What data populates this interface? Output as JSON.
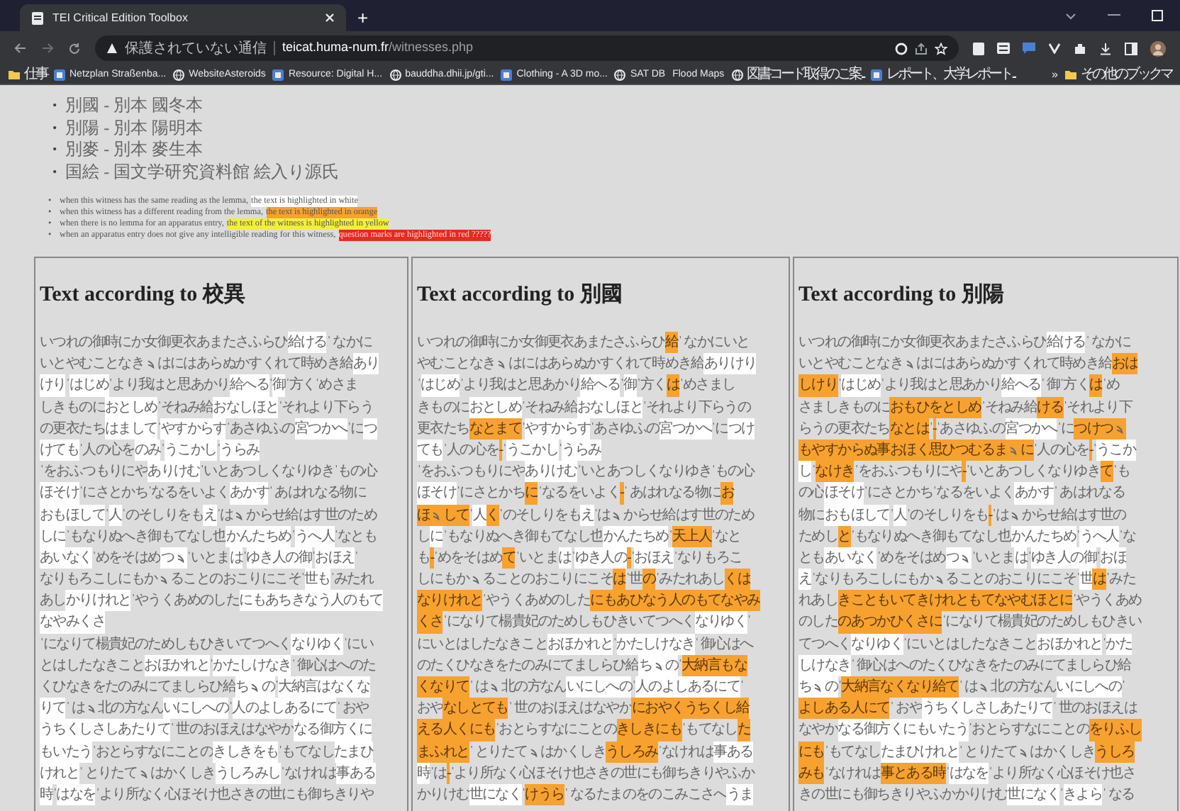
{
  "browser": {
    "tab": {
      "title": "TEI Critical Edition Toolbox",
      "selected": true
    },
    "new_tab": "+",
    "address": {
      "security": "保護されていない通信",
      "host": "teicat.huma-num.fr",
      "path": "/witnesses.php"
    },
    "bookmarks": [
      {
        "label": "仕事"
      },
      {
        "label": "Netzplan Straßenba..."
      },
      {
        "label": "WebsiteAsteroids"
      },
      {
        "label": "Resource: Digital H..."
      },
      {
        "label": "bauddha.dhii.jp/gti..."
      },
      {
        "label": "Clothing - A 3D mo..."
      },
      {
        "label": "SAT DB"
      },
      {
        "label": "Flood Maps"
      },
      {
        "label": "図書コード取得のご案..."
      },
      {
        "label": "レポート、大学レポート..."
      }
    ],
    "more": "»",
    "other_bookmarks": "その他のブックマ"
  },
  "witnesses": [
    {
      "bullet": "•",
      "text": "別國 - 別本 國冬本"
    },
    {
      "bullet": "•",
      "text": "別陽 - 別本 陽明本"
    },
    {
      "bullet": "•",
      "text": "別麥 - 別本 麥生本"
    },
    {
      "bullet": "•",
      "text": "国絵 - 国文学研究資料館 絵入り源氏"
    }
  ],
  "legend": [
    {
      "bullet": "•",
      "lead": "when this witness has the same reading as the lemma,",
      "highlight": "the text is highlighted in white",
      "kind": "same"
    },
    {
      "bullet": "•",
      "lead": "when this witness has a different reading from the lemma,",
      "highlight": "the text is highlighted in orange",
      "kind": "different"
    },
    {
      "bullet": "•",
      "lead": "when there is no lemma for an apparatus entry,",
      "highlight": "the text of the witness is highlighted in yellow",
      "kind": "no_lemma"
    },
    {
      "bullet": "•",
      "lead": "when an apparatus entry does not give any intelligible reading for this witness,",
      "highlight": "question marks are highlighted in red ?????",
      "kind": "unintelligible"
    }
  ],
  "columns": [
    {
      "heading": "Text according to 校異",
      "lines": [
        [
          {
            "kind": "plain",
            "text": "いつれの御時にか女御更衣あまたさふらひ "
          },
          {
            "kind": "same",
            "text": "給ける"
          },
          {
            "kind": "plain",
            "text": "ˈ なかに"
          }
        ],
        [
          {
            "kind": "plain",
            "text": "いとやむことなき"
          },
          {
            "kind": "repeat_plain"
          },
          {
            "kind": "plain",
            "text": "はにはあらぬかすくれて時めき給 "
          },
          {
            "kind": "same",
            "text": "あり"
          }
        ],
        [
          {
            "kind": "same",
            "text": "けり"
          },
          {
            "kind": "plain",
            "text": "ˈ "
          },
          {
            "kind": "same",
            "text": "はじめ"
          },
          {
            "kind": "plain",
            "text": "ˈより我はと思あかり "
          },
          {
            "kind": "same",
            "text": "給へる"
          },
          {
            "kind": "plain",
            "text": "ˈ "
          },
          {
            "kind": "same",
            "text": "御"
          },
          {
            "kind": "plain",
            "text": "ˈ方くˈめさま"
          }
        ],
        [
          {
            "kind": "plain",
            "text": "しきものに"
          },
          {
            "kind": "same",
            "text": "おとしめ"
          },
          {
            "kind": "plain",
            "text": "ˈそねみ給"
          },
          {
            "kind": "same",
            "text": "おなしほと"
          },
          {
            "kind": "plain",
            "text": "ˈそれより下らう"
          }
        ],
        [
          {
            "kind": "plain",
            "text": "の更衣たち"
          },
          {
            "kind": "same",
            "text": "はまして"
          },
          {
            "kind": "plain",
            "text": "ˈ"
          },
          {
            "kind": "same",
            "text": "やすからす"
          },
          {
            "kind": "plain",
            "text": "ˈあさゆふの"
          },
          {
            "kind": "same",
            "text": "宮つかへ"
          },
          {
            "kind": "plain",
            "text": "ˈに"
          },
          {
            "kind": "same",
            "text": "つ"
          }
        ],
        [
          {
            "kind": "same",
            "text": "けても"
          },
          {
            "kind": "plain",
            "text": "ˈ人の心を"
          },
          {
            "kind": "same",
            "text": "のみ"
          },
          {
            "kind": "plain",
            "text": "ˈ"
          },
          {
            "kind": "same",
            "text": "うこかし"
          },
          {
            "kind": "plain",
            "text": "ˈ"
          },
          {
            "kind": "same",
            "text": "うらみ"
          }
        ],
        [
          {
            "kind": "plain",
            "text": "ˈをおふつもりにや"
          },
          {
            "kind": "same",
            "text": "ありけむ"
          },
          {
            "kind": "plain",
            "text": "ˈいとあつしくなりゆきˈもの心"
          }
        ],
        [
          {
            "kind": "same",
            "text": "ほそけ"
          },
          {
            "kind": "plain",
            "text": "ˈにさとかちˈなるをいよく"
          },
          {
            "kind": "same",
            "text": "あかす"
          },
          {
            "kind": "plain",
            "text": "ˈ あはれなる物に"
          }
        ],
        [
          {
            "kind": "same",
            "text": "おもほして"
          },
          {
            "kind": "plain",
            "text": "ˈ"
          },
          {
            "kind": "same",
            "text": "人"
          },
          {
            "kind": "plain",
            "text": "ˈのそしりをも"
          },
          {
            "kind": "same",
            "text": "え"
          },
          {
            "kind": "plain",
            "text": "ˈは"
          },
          {
            "kind": "repeat_plain"
          },
          {
            "kind": "plain",
            "text": "からせ給はす世のため"
          }
        ],
        [
          {
            "kind": "same",
            "text": "しに"
          },
          {
            "kind": "plain",
            "text": "ˈもなりぬへき御もてなし也"
          },
          {
            "kind": "same",
            "text": "かんたちめ"
          },
          {
            "kind": "plain",
            "text": "ˈ"
          },
          {
            "kind": "same",
            "text": "うへ人"
          },
          {
            "kind": "plain",
            "text": "ˈなとも"
          }
        ],
        [
          {
            "kind": "same",
            "text": "あいなく"
          },
          {
            "kind": "plain",
            "text": "ˈめをそはめ"
          },
          {
            "kind": "same",
            "text": "つ"
          },
          {
            "kind": "repeat_same"
          },
          {
            "kind": "plain",
            "text": "ˈいとま"
          },
          {
            "kind": "same",
            "text": "は"
          },
          {
            "kind": "plain",
            "text": "ˈ"
          },
          {
            "kind": "same",
            "text": "ゆき人の御"
          },
          {
            "kind": "plain",
            "text": "ˈ"
          },
          {
            "kind": "same",
            "text": "おほえ"
          },
          {
            "kind": "plain",
            "text": "ˈ"
          }
        ],
        [
          {
            "kind": "plain",
            "text": "なりもろこしにもか"
          },
          {
            "kind": "repeat_plain"
          },
          {
            "kind": "plain",
            "text": "ることのおこりにこそˈ"
          },
          {
            "kind": "same",
            "text": "世も"
          },
          {
            "kind": "plain",
            "text": "ˈみたれ"
          }
        ],
        [
          {
            "kind": "plain",
            "text": "あし"
          },
          {
            "kind": "same",
            "text": "かりけれと"
          },
          {
            "kind": "plain",
            "text": "ˈやうくあめのした"
          },
          {
            "kind": "same",
            "text": "にもあちきなう人のもて"
          }
        ],
        [
          {
            "kind": "same",
            "text": "なやみくさ"
          }
        ],
        [
          {
            "kind": "plain",
            "text": "ˈになりて楊貴妃のためしもひきいてつへく"
          },
          {
            "kind": "same",
            "text": "なりゆく"
          },
          {
            "kind": "plain",
            "text": "ˈにい"
          }
        ],
        [
          {
            "kind": "plain",
            "text": "とはしたなきこと"
          },
          {
            "kind": "same",
            "text": "おほかれと"
          },
          {
            "kind": "plain",
            "text": "ˈ "
          },
          {
            "kind": "same",
            "text": "かたしけなき"
          },
          {
            "kind": "plain",
            "text": "ˈ 御心はへのた"
          }
        ],
        [
          {
            "kind": "plain",
            "text": "くひなきをたのみにてましらひ給"
          },
          {
            "kind": "same",
            "text": "ち"
          },
          {
            "kind": "repeat_same"
          },
          {
            "kind": "same",
            "text": "の"
          },
          {
            "kind": "plain",
            "text": "ˈ "
          },
          {
            "kind": "same",
            "text": "大納言はなくな"
          }
        ],
        [
          {
            "kind": "same",
            "text": "りて"
          },
          {
            "kind": "plain",
            "text": "ˈ は"
          },
          {
            "kind": "repeat_plain"
          },
          {
            "kind": "plain",
            "text": "北の方なん"
          },
          {
            "kind": "same",
            "text": "いにしへの"
          },
          {
            "kind": "plain",
            "text": "ˈ "
          },
          {
            "kind": "same",
            "text": "人のよしあるにて"
          },
          {
            "kind": "plain",
            "text": "ˈ おや"
          }
        ],
        [
          {
            "kind": "same",
            "text": "うちくしさしあたりて"
          },
          {
            "kind": "plain",
            "text": "ˈ 世のおほえはなやか"
          },
          {
            "kind": "same",
            "text": "なる御方くに"
          }
        ],
        [
          {
            "kind": "same",
            "text": "もいたう"
          },
          {
            "kind": "plain",
            "text": "ˈおとらすなにことの"
          },
          {
            "kind": "same",
            "text": "きしきをも"
          },
          {
            "kind": "plain",
            "text": "ˈもてなし "
          },
          {
            "kind": "same",
            "text": "たまひ"
          }
        ],
        [
          {
            "kind": "same",
            "text": "けれと"
          },
          {
            "kind": "plain",
            "text": "ˈ とりたて"
          },
          {
            "kind": "repeat_plain"
          },
          {
            "kind": "plain",
            "text": "はかくしき"
          },
          {
            "kind": "same",
            "text": "うしろみし"
          },
          {
            "kind": "plain",
            "text": "ˈなけれは"
          },
          {
            "kind": "same",
            "text": "事ある"
          }
        ],
        [
          {
            "kind": "same",
            "text": "時"
          },
          {
            "kind": "plain",
            "text": "ˈ"
          },
          {
            "kind": "same",
            "text": "はなを"
          },
          {
            "kind": "plain",
            "text": "ˈより所なく心ほそけ也さきの世にも御ちきりや"
          }
        ]
      ]
    },
    {
      "heading": "Text according to 別國",
      "lines": [
        [
          {
            "kind": "plain",
            "text": "いつれの御時にか女御更衣あまたさふらひ "
          },
          {
            "kind": "different",
            "text": "給"
          },
          {
            "kind": "plain",
            "text": "ˈ なかにいと"
          }
        ],
        [
          {
            "kind": "plain",
            "text": "やむことなき"
          },
          {
            "kind": "repeat_plain"
          },
          {
            "kind": "plain",
            "text": "はにはあらぬかすくれて時めき給 "
          },
          {
            "kind": "same",
            "text": "ありけり"
          }
        ],
        [
          {
            "kind": "plain",
            "text": "ˈ "
          },
          {
            "kind": "same",
            "text": "はじめ"
          },
          {
            "kind": "plain",
            "text": "ˈより我はと思あかり "
          },
          {
            "kind": "same",
            "text": "給へる"
          },
          {
            "kind": "plain",
            "text": "ˈ "
          },
          {
            "kind": "same",
            "text": "御"
          },
          {
            "kind": "plain",
            "text": "ˈ方く"
          },
          {
            "kind": "different",
            "text": "は"
          },
          {
            "kind": "plain",
            "text": "ˈめさまし"
          }
        ],
        [
          {
            "kind": "plain",
            "text": "きものに"
          },
          {
            "kind": "same",
            "text": "おとしめ"
          },
          {
            "kind": "plain",
            "text": "ˈそねみ給"
          },
          {
            "kind": "same",
            "text": "おなしほと"
          },
          {
            "kind": "plain",
            "text": "ˈそれより下らうの"
          }
        ],
        [
          {
            "kind": "plain",
            "text": "更衣たち"
          },
          {
            "kind": "different",
            "text": "なとまて"
          },
          {
            "kind": "plain",
            "text": "ˈ"
          },
          {
            "kind": "same",
            "text": "やすからす"
          },
          {
            "kind": "plain",
            "text": "ˈあさゆふの"
          },
          {
            "kind": "same",
            "text": "宮つかへ"
          },
          {
            "kind": "plain",
            "text": "ˈに"
          },
          {
            "kind": "same",
            "text": "つけ"
          }
        ],
        [
          {
            "kind": "same",
            "text": "ても"
          },
          {
            "kind": "plain",
            "text": "ˈ人の心を"
          },
          {
            "kind": "different",
            "text": "-"
          },
          {
            "kind": "plain",
            "text": "ˈ"
          },
          {
            "kind": "same",
            "text": "うこかし"
          },
          {
            "kind": "plain",
            "text": "ˈ"
          },
          {
            "kind": "same",
            "text": "うらみ"
          }
        ],
        [
          {
            "kind": "plain",
            "text": "ˈをおふつもりにや"
          },
          {
            "kind": "same",
            "text": "ありけむ"
          },
          {
            "kind": "plain",
            "text": "ˈいとあつしくなりゆきˈもの心"
          }
        ],
        [
          {
            "kind": "same",
            "text": "ほそけ"
          },
          {
            "kind": "plain",
            "text": "ˈにさとかち"
          },
          {
            "kind": "different",
            "text": "に"
          },
          {
            "kind": "plain",
            "text": "ˈなるをいよく"
          },
          {
            "kind": "different",
            "text": "-"
          },
          {
            "kind": "plain",
            "text": "ˈ あはれなる物に "
          },
          {
            "kind": "different",
            "text": "お"
          }
        ],
        [
          {
            "kind": "different",
            "text": "ほ"
          },
          {
            "kind": "repeat_different"
          },
          {
            "kind": "different",
            "text": "して"
          },
          {
            "kind": "plain",
            "text": "ˈ"
          },
          {
            "kind": "same",
            "text": "人"
          },
          {
            "kind": "different",
            "text": "く"
          },
          {
            "kind": "plain",
            "text": "ˈのそしりをも"
          },
          {
            "kind": "same",
            "text": "え"
          },
          {
            "kind": "plain",
            "text": "ˈは"
          },
          {
            "kind": "repeat_plain"
          },
          {
            "kind": "plain",
            "text": "からせ給はす世のため"
          }
        ],
        [
          {
            "kind": "plain",
            "text": "し"
          },
          {
            "kind": "same",
            "text": "に"
          },
          {
            "kind": "plain",
            "text": "ˈもなりぬへき御もてなし也"
          },
          {
            "kind": "same",
            "text": "かんたちめ"
          },
          {
            "kind": "plain",
            "text": "ˈ"
          },
          {
            "kind": "different",
            "text": "天上人"
          },
          {
            "kind": "plain",
            "text": "ˈなと"
          }
        ],
        [
          {
            "kind": "plain",
            "text": "も"
          },
          {
            "kind": "different",
            "text": "-"
          },
          {
            "kind": "plain",
            "text": "ˈめをそはめ"
          },
          {
            "kind": "different",
            "text": "て"
          },
          {
            "kind": "plain",
            "text": "ˈいとま"
          },
          {
            "kind": "same",
            "text": "は"
          },
          {
            "kind": "plain",
            "text": "ˈ"
          },
          {
            "kind": "same",
            "text": "ゆき人の"
          },
          {
            "kind": "different",
            "text": "-"
          },
          {
            "kind": "plain",
            "text": "ˈ"
          },
          {
            "kind": "same",
            "text": "おほえ"
          },
          {
            "kind": "plain",
            "text": "ˈなりもろこ"
          }
        ],
        [
          {
            "kind": "plain",
            "text": "しにもか"
          },
          {
            "kind": "repeat_plain"
          },
          {
            "kind": "plain",
            "text": "ることのおこりにこそ"
          },
          {
            "kind": "different",
            "text": "は"
          },
          {
            "kind": "plain",
            "text": "ˈ世"
          },
          {
            "kind": "different",
            "text": "の"
          },
          {
            "kind": "plain",
            "text": "ˈみたれあし"
          },
          {
            "kind": "different",
            "text": "くは"
          }
        ],
        [
          {
            "kind": "different",
            "text": "なりけれと"
          },
          {
            "kind": "plain",
            "text": "ˈやうくあめのした"
          },
          {
            "kind": "different",
            "text": "にもあひなう人のもてなやみ"
          }
        ],
        [
          {
            "kind": "different",
            "text": "くさ"
          },
          {
            "kind": "plain",
            "text": "ˈになりて楊貴妃のためしもひきいてつへく"
          },
          {
            "kind": "same",
            "text": "なりゆく"
          },
          {
            "kind": "plain",
            "text": "ˈ"
          }
        ],
        [
          {
            "kind": "plain",
            "text": "にいとはしたなきこと"
          },
          {
            "kind": "same",
            "text": "おほかれと"
          },
          {
            "kind": "plain",
            "text": "ˈ "
          },
          {
            "kind": "same",
            "text": "かたしけなき"
          },
          {
            "kind": "plain",
            "text": "ˈ 御心はへ"
          }
        ],
        [
          {
            "kind": "plain",
            "text": "のたくひなきをたのみにてましらひ給"
          },
          {
            "kind": "same",
            "text": "ち"
          },
          {
            "kind": "repeat_same"
          },
          {
            "kind": "same",
            "text": "の"
          },
          {
            "kind": "plain",
            "text": "ˈ "
          },
          {
            "kind": "different",
            "text": "大納言もな"
          }
        ],
        [
          {
            "kind": "different",
            "text": "くなりて"
          },
          {
            "kind": "plain",
            "text": "ˈ は"
          },
          {
            "kind": "repeat_plain"
          },
          {
            "kind": "plain",
            "text": "北の方なん"
          },
          {
            "kind": "same",
            "text": "いにしへの"
          },
          {
            "kind": "plain",
            "text": "ˈ "
          },
          {
            "kind": "same",
            "text": "人のよしあるにて"
          },
          {
            "kind": "plain",
            "text": "ˈ"
          }
        ],
        [
          {
            "kind": "plain",
            "text": "おや"
          },
          {
            "kind": "different",
            "text": "なしとても"
          },
          {
            "kind": "plain",
            "text": "ˈ 世のおほえはなやか"
          },
          {
            "kind": "different",
            "text": "におやくうちくし給"
          }
        ],
        [
          {
            "kind": "different",
            "text": "える人くにも"
          },
          {
            "kind": "plain",
            "text": "ˈおとらすなにことの"
          },
          {
            "kind": "different",
            "text": "きしきにも"
          },
          {
            "kind": "plain",
            "text": "ˈもてなし "
          },
          {
            "kind": "different",
            "text": "た"
          }
        ],
        [
          {
            "kind": "different",
            "text": "まふれと"
          },
          {
            "kind": "plain",
            "text": "ˈ とりたて"
          },
          {
            "kind": "repeat_plain"
          },
          {
            "kind": "plain",
            "text": "はかくしき"
          },
          {
            "kind": "different",
            "text": "うしろみ"
          },
          {
            "kind": "plain",
            "text": "ˈなけれは"
          },
          {
            "kind": "same",
            "text": "事ある"
          }
        ],
        [
          {
            "kind": "same",
            "text": "時"
          },
          {
            "kind": "plain",
            "text": "ˈは"
          },
          {
            "kind": "different",
            "text": "-"
          },
          {
            "kind": "plain",
            "text": "ˈより所なく心ほそけ也さきの世にも御ちきりやふか"
          }
        ],
        [
          {
            "kind": "plain",
            "text": "かりけむ"
          },
          {
            "kind": "same",
            "text": "世になく"
          },
          {
            "kind": "plain",
            "text": "ˈ "
          },
          {
            "kind": "different",
            "text": "けうら"
          },
          {
            "kind": "plain",
            "text": "ˈ なるたまのをのこみこさへ"
          },
          {
            "kind": "same",
            "text": "うま"
          }
        ]
      ]
    },
    {
      "heading": "Text according to 別陽",
      "lines": [
        [
          {
            "kind": "plain",
            "text": "いつれの御時にか女御更衣あまたさふらひ "
          },
          {
            "kind": "same",
            "text": "給ける"
          },
          {
            "kind": "plain",
            "text": "ˈ なかに"
          }
        ],
        [
          {
            "kind": "plain",
            "text": "いとやむことなき"
          },
          {
            "kind": "repeat_plain"
          },
          {
            "kind": "plain",
            "text": "はにはあらぬかすくれて時めき給 "
          },
          {
            "kind": "different",
            "text": "おは"
          }
        ],
        [
          {
            "kind": "different",
            "text": "しけり"
          },
          {
            "kind": "plain",
            "text": "ˈ "
          },
          {
            "kind": "same",
            "text": "はじめ"
          },
          {
            "kind": "plain",
            "text": "ˈより我はと思あかり "
          },
          {
            "kind": "same",
            "text": "給へる"
          },
          {
            "kind": "plain",
            "text": "ˈ 御ˈ方く"
          },
          {
            "kind": "different",
            "text": "は"
          },
          {
            "kind": "plain",
            "text": "ˈめ"
          }
        ],
        [
          {
            "kind": "plain",
            "text": "さましきものに"
          },
          {
            "kind": "different",
            "text": "おもひをとしめ"
          },
          {
            "kind": "plain",
            "text": "ˈそねみ給"
          },
          {
            "kind": "different",
            "text": "ける"
          },
          {
            "kind": "plain",
            "text": "ˈそれより下"
          }
        ],
        [
          {
            "kind": "plain",
            "text": "らうの更衣たち"
          },
          {
            "kind": "different",
            "text": "なとは"
          },
          {
            "kind": "plain",
            "text": "ˈ"
          },
          {
            "kind": "different",
            "text": "-"
          },
          {
            "kind": "plain",
            "text": "ˈあさゆふの"
          },
          {
            "kind": "same",
            "text": "宮つかへ"
          },
          {
            "kind": "plain",
            "text": "ˈに"
          },
          {
            "kind": "different",
            "text": "つけつ"
          },
          {
            "kind": "repeat_different"
          }
        ],
        [
          {
            "kind": "different",
            "text": "もやすからぬ事おほく思ひつむるま"
          },
          {
            "kind": "repeat_different"
          },
          {
            "kind": "different",
            "text": "に"
          },
          {
            "kind": "plain",
            "text": "ˈ人の心を"
          },
          {
            "kind": "different",
            "text": "-"
          },
          {
            "kind": "plain",
            "text": "ˈ"
          },
          {
            "kind": "same",
            "text": "うこか"
          }
        ],
        [
          {
            "kind": "same",
            "text": "し"
          },
          {
            "kind": "plain",
            "text": "ˈ"
          },
          {
            "kind": "different",
            "text": "なけき"
          },
          {
            "kind": "plain",
            "text": "ˈをおふつもりにや"
          },
          {
            "kind": "different",
            "text": "-"
          },
          {
            "kind": "plain",
            "text": "ˈいとあつしくなりゆき"
          },
          {
            "kind": "different",
            "text": "て"
          },
          {
            "kind": "plain",
            "text": "ˈも"
          }
        ],
        [
          {
            "kind": "plain",
            "text": "の心"
          },
          {
            "kind": "same",
            "text": "ほそけ"
          },
          {
            "kind": "plain",
            "text": "ˈにさとかちˈなるをいよく"
          },
          {
            "kind": "same",
            "text": "あかす"
          },
          {
            "kind": "plain",
            "text": "ˈ あはれなる"
          }
        ],
        [
          {
            "kind": "plain",
            "text": "物に "
          },
          {
            "kind": "same",
            "text": "おもほして"
          },
          {
            "kind": "plain",
            "text": "ˈ"
          },
          {
            "kind": "same",
            "text": "人"
          },
          {
            "kind": "plain",
            "text": "ˈのそしりをも"
          },
          {
            "kind": "different",
            "text": "-"
          },
          {
            "kind": "plain",
            "text": "ˈは"
          },
          {
            "kind": "repeat_plain"
          },
          {
            "kind": "plain",
            "text": "からせ給はす世の"
          }
        ],
        [
          {
            "kind": "plain",
            "text": "ためし"
          },
          {
            "kind": "different",
            "text": "と"
          },
          {
            "kind": "plain",
            "text": "ˈもなりぬへき御もてなし也"
          },
          {
            "kind": "same",
            "text": "かんたちめ"
          },
          {
            "kind": "plain",
            "text": "ˈ"
          },
          {
            "kind": "same",
            "text": "うへ人"
          },
          {
            "kind": "plain",
            "text": "ˈな"
          }
        ],
        [
          {
            "kind": "plain",
            "text": "とも"
          },
          {
            "kind": "same",
            "text": "あいなく"
          },
          {
            "kind": "plain",
            "text": "ˈめをそはめ"
          },
          {
            "kind": "same",
            "text": "つ"
          },
          {
            "kind": "repeat_same"
          },
          {
            "kind": "plain",
            "text": "ˈいとま"
          },
          {
            "kind": "same",
            "text": "は"
          },
          {
            "kind": "plain",
            "text": "ˈ"
          },
          {
            "kind": "same",
            "text": "ゆき人の御"
          },
          {
            "kind": "plain",
            "text": "ˈ"
          },
          {
            "kind": "same",
            "text": "おほ"
          }
        ],
        [
          {
            "kind": "same",
            "text": "え"
          },
          {
            "kind": "plain",
            "text": "ˈなりもろこしにもか"
          },
          {
            "kind": "repeat_plain"
          },
          {
            "kind": "plain",
            "text": "ることのおこりにこそˈ"
          },
          {
            "kind": "same",
            "text": "世"
          },
          {
            "kind": "different",
            "text": "は"
          },
          {
            "kind": "plain",
            "text": "ˈみた"
          }
        ],
        [
          {
            "kind": "plain",
            "text": "れあし"
          },
          {
            "kind": "different",
            "text": "きこともいてきけれともてなやむほとに"
          },
          {
            "kind": "plain",
            "text": "ˈやうくあめ"
          }
        ],
        [
          {
            "kind": "plain",
            "text": "のした"
          },
          {
            "kind": "different",
            "text": "のあつかひくさに"
          },
          {
            "kind": "plain",
            "text": "ˈになりて楊貴妃のためしもひきい"
          }
        ],
        [
          {
            "kind": "plain",
            "text": "てつへく"
          },
          {
            "kind": "same",
            "text": "なりゆく"
          },
          {
            "kind": "plain",
            "text": "ˈにいとはしたなきこと"
          },
          {
            "kind": "same",
            "text": "おほかれと"
          },
          {
            "kind": "plain",
            "text": "ˈ "
          },
          {
            "kind": "same",
            "text": "かた"
          }
        ],
        [
          {
            "kind": "same",
            "text": "しけなき"
          },
          {
            "kind": "plain",
            "text": "ˈ 御心はへのたくひなきをたのみにてましらひ給"
          }
        ],
        [
          {
            "kind": "same",
            "text": "ち"
          },
          {
            "kind": "repeat_same"
          },
          {
            "kind": "same",
            "text": "の"
          },
          {
            "kind": "plain",
            "text": "ˈ "
          },
          {
            "kind": "different",
            "text": "大納言なくなり給て"
          },
          {
            "kind": "plain",
            "text": "ˈ は"
          },
          {
            "kind": "repeat_plain"
          },
          {
            "kind": "plain",
            "text": "北の方なん"
          },
          {
            "kind": "same",
            "text": "いにしへの"
          },
          {
            "kind": "plain",
            "text": "ˈ"
          }
        ],
        [
          {
            "kind": "different",
            "text": "よしある人にて"
          },
          {
            "kind": "plain",
            "text": "ˈ おや"
          },
          {
            "kind": "same",
            "text": "うちくしさしあたりて"
          },
          {
            "kind": "plain",
            "text": "ˈ 世のおほえは"
          }
        ],
        [
          {
            "kind": "plain",
            "text": "なやか"
          },
          {
            "kind": "same",
            "text": "なる御方くにもいたう"
          },
          {
            "kind": "plain",
            "text": "ˈおとらすなにことの"
          },
          {
            "kind": "different",
            "text": "をりふし"
          }
        ],
        [
          {
            "kind": "different",
            "text": "にも"
          },
          {
            "kind": "plain",
            "text": "ˈもてなし "
          },
          {
            "kind": "same",
            "text": "たまひけれと"
          },
          {
            "kind": "plain",
            "text": "ˈ とりたて"
          },
          {
            "kind": "repeat_plain"
          },
          {
            "kind": "plain",
            "text": "はかくしき"
          },
          {
            "kind": "different",
            "text": "うしろ"
          }
        ],
        [
          {
            "kind": "different",
            "text": "みも"
          },
          {
            "kind": "plain",
            "text": "ˈなけれは"
          },
          {
            "kind": "different",
            "text": "事とある時"
          },
          {
            "kind": "plain",
            "text": "ˈ"
          },
          {
            "kind": "same",
            "text": "はなを"
          },
          {
            "kind": "plain",
            "text": "ˈより所なく心ほそけ也さ"
          }
        ],
        [
          {
            "kind": "plain",
            "text": "きの世にも御ちきりやふかかりけむ"
          },
          {
            "kind": "same",
            "text": "世になく"
          },
          {
            "kind": "plain",
            "text": "ˈ "
          },
          {
            "kind": "same",
            "text": "きよら"
          },
          {
            "kind": "plain",
            "text": "ˈ なる"
          }
        ]
      ]
    }
  ]
}
